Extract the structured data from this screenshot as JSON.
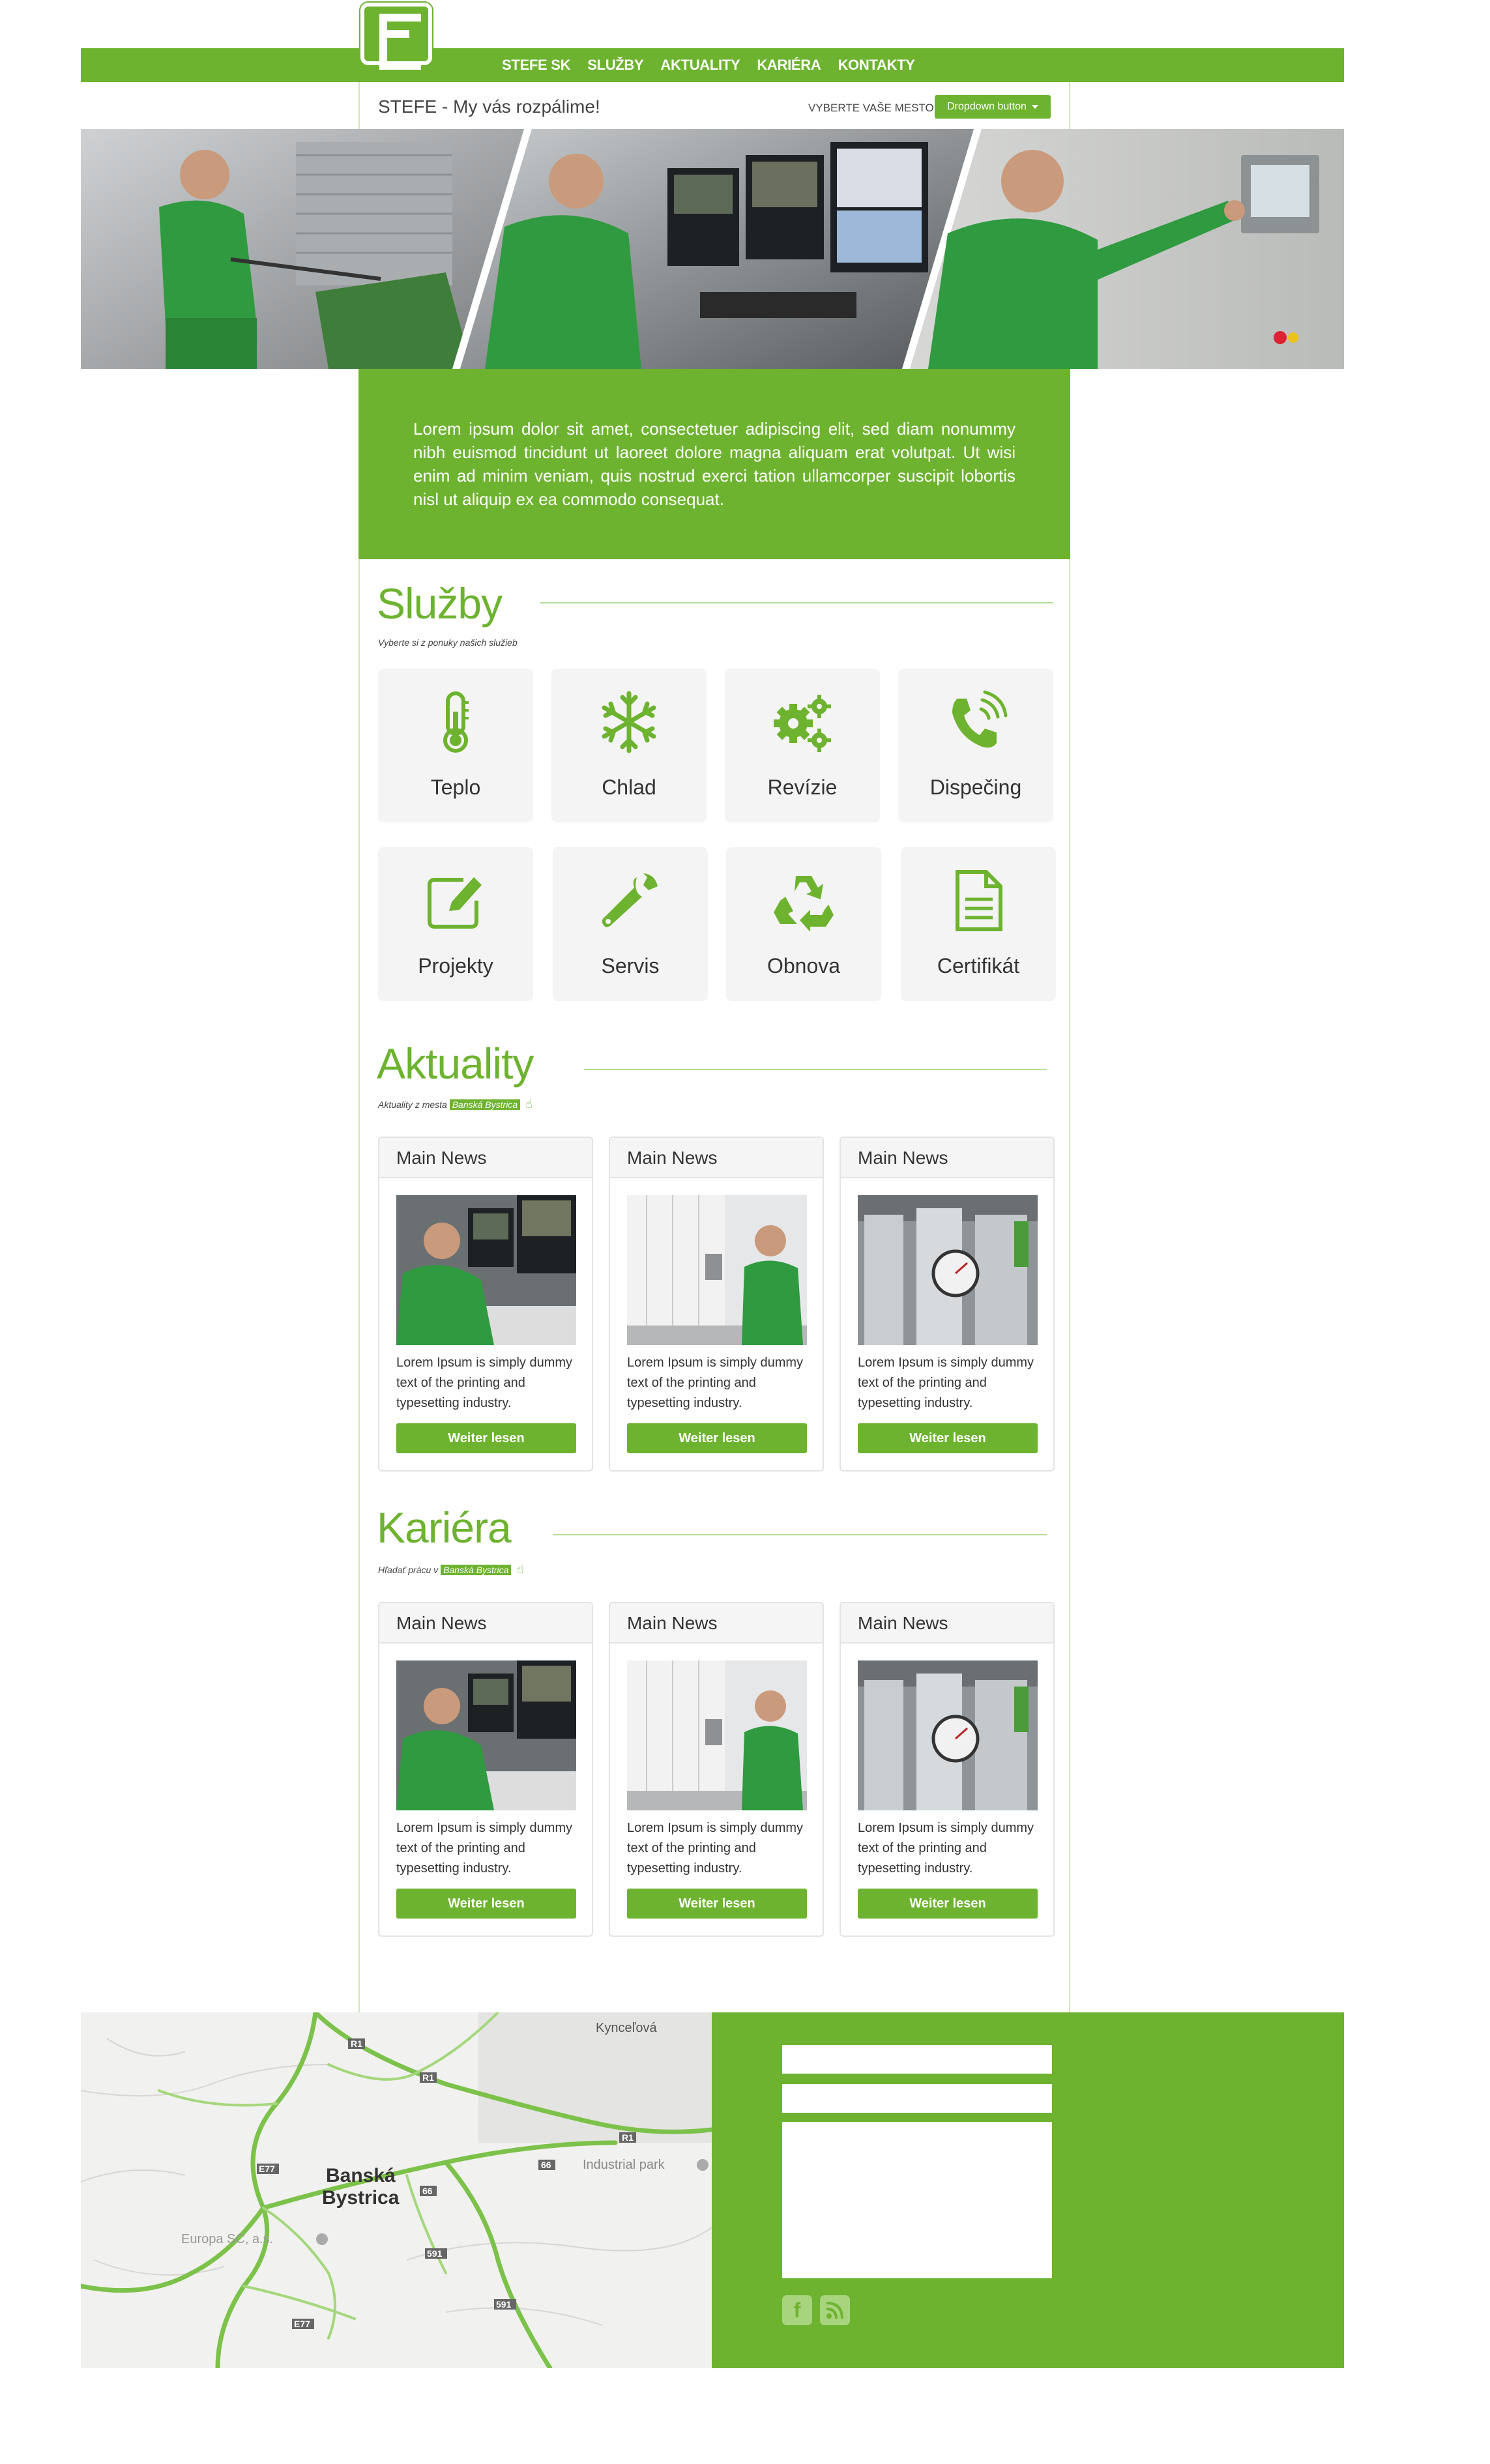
{
  "nav": {
    "items": [
      "STEFE SK",
      "SLUŽBY",
      "AKTUALITY",
      "KARIÉRA",
      "KONTAKTY"
    ]
  },
  "header": {
    "tagline": "STEFE - My vás rozpálime!",
    "city_label": "VYBERTE VAŠE MESTO",
    "dropdown_label": "Dropdown button"
  },
  "intro": {
    "text": "Lorem ipsum dolor sit amet, consectetuer adipiscing elit, sed diam nonummy nibh euismod tincidunt ut laoreet dolore magna aliquam erat volutpat. Ut wisi enim ad minim veniam, quis nostrud exerci tation ullamcorper suscipit lobortis nisl ut aliquip ex ea commodo consequat."
  },
  "services": {
    "title": "Služby",
    "subtitle": "Vyberte si z ponuky našich služieb",
    "items": [
      {
        "label": "Teplo",
        "icon": "thermometer-icon"
      },
      {
        "label": "Chlad",
        "icon": "snowflake-icon"
      },
      {
        "label": "Revízie",
        "icon": "gears-icon"
      },
      {
        "label": "Dispečing",
        "icon": "phone-icon"
      },
      {
        "label": "Projekty",
        "icon": "edit-icon"
      },
      {
        "label": "Servis",
        "icon": "wrench-icon"
      },
      {
        "label": "Obnova",
        "icon": "recycle-icon"
      },
      {
        "label": "Certifikát",
        "icon": "document-icon"
      }
    ]
  },
  "news": {
    "title": "Aktuality",
    "subtitle_prefix": "Aktuality z mesta",
    "city": "Banská Bystrica",
    "cards": [
      {
        "title": "Main News",
        "text": "Lorem Ipsum is simply dummy text of the printing and typesetting industry.",
        "button": "Weiter lesen"
      },
      {
        "title": "Main News",
        "text": "Lorem Ipsum is simply dummy text of the printing and typesetting industry.",
        "button": "Weiter lesen"
      },
      {
        "title": "Main News",
        "text": "Lorem Ipsum is simply dummy text of the printing and typesetting industry.",
        "button": "Weiter lesen"
      }
    ]
  },
  "career": {
    "title": "Kariéra",
    "subtitle_prefix": "Hľadať prácu v",
    "city": "Banská Bystrica",
    "cards": [
      {
        "title": "Main News",
        "text": "Lorem Ipsum is simply dummy text of the printing and typesetting industry.",
        "button": "Weiter lesen"
      },
      {
        "title": "Main News",
        "text": "Lorem Ipsum is simply dummy text of the printing and typesetting industry.",
        "button": "Weiter lesen"
      },
      {
        "title": "Main News",
        "text": "Lorem Ipsum is simply dummy text of the printing and typesetting industry.",
        "button": "Weiter lesen"
      }
    ]
  },
  "map": {
    "city_line1": "Banská",
    "city_line2": "Bystrica",
    "labels": [
      "Kynceľová",
      "Industrial park",
      "Europa SC, a.s."
    ],
    "road_labels": [
      "R1",
      "R1",
      "R1",
      "E77",
      "E77",
      "66",
      "66",
      "591",
      "591"
    ]
  },
  "colors": {
    "accent": "#6db32f",
    "light_accent": "#b7dc94",
    "panel": "#f4f4f4"
  }
}
